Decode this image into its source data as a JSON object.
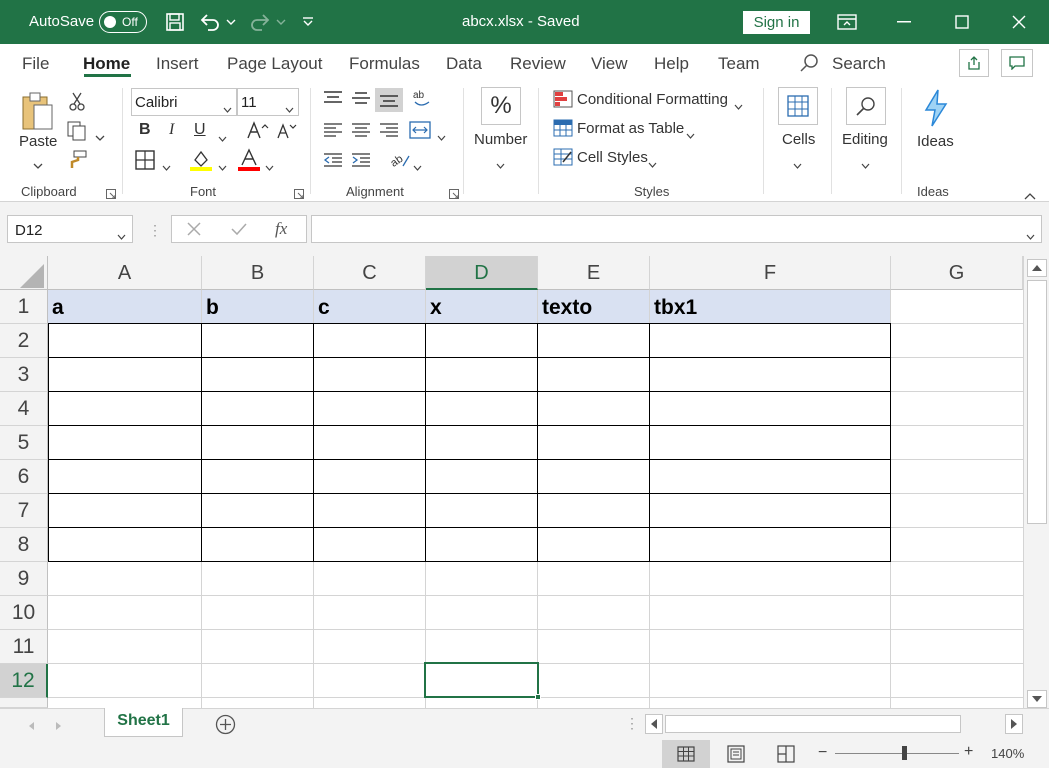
{
  "titlebar": {
    "autosave_label": "AutoSave",
    "autosave_state": "Off",
    "file_title": "abcx.xlsx  -  Saved",
    "signin_label": "Sign in"
  },
  "tabs": [
    "File",
    "Home",
    "Insert",
    "Page Layout",
    "Formulas",
    "Data",
    "Review",
    "View",
    "Help",
    "Team"
  ],
  "search_label": "Search",
  "ribbon": {
    "clipboard": {
      "paste_label": "Paste",
      "group_label": "Clipboard"
    },
    "font": {
      "font_name": "Calibri",
      "font_size": "11",
      "bold": "B",
      "italic": "I",
      "underline": "U",
      "group_label": "Font"
    },
    "alignment": {
      "group_label": "Alignment"
    },
    "number": {
      "label": "Number",
      "icon_glyph": "%"
    },
    "styles": {
      "conditional_formatting": "Conditional Formatting",
      "format_as_table": "Format as Table",
      "cell_styles": "Cell Styles",
      "group_label": "Styles"
    },
    "cells": {
      "label": "Cells"
    },
    "editing": {
      "label": "Editing"
    },
    "ideas": {
      "label": "Ideas",
      "group_label": "Ideas"
    }
  },
  "formula_bar": {
    "name_box": "D12",
    "fx_glyph": "fx",
    "formula": ""
  },
  "columns": [
    "A",
    "B",
    "C",
    "D",
    "E",
    "F",
    "G"
  ],
  "selected_column": "D",
  "rows": [
    "1",
    "2",
    "3",
    "4",
    "5",
    "6",
    "7",
    "8",
    "9",
    "10",
    "11",
    "12"
  ],
  "selected_row": "12",
  "header_row_values": [
    "a",
    "b",
    "c",
    "x",
    "texto",
    "tbx1"
  ],
  "sheet_tab": "Sheet1",
  "status": {
    "zoom": "140%"
  },
  "colors": {
    "brand": "#217346",
    "header_fill": "#d9e1f2"
  }
}
